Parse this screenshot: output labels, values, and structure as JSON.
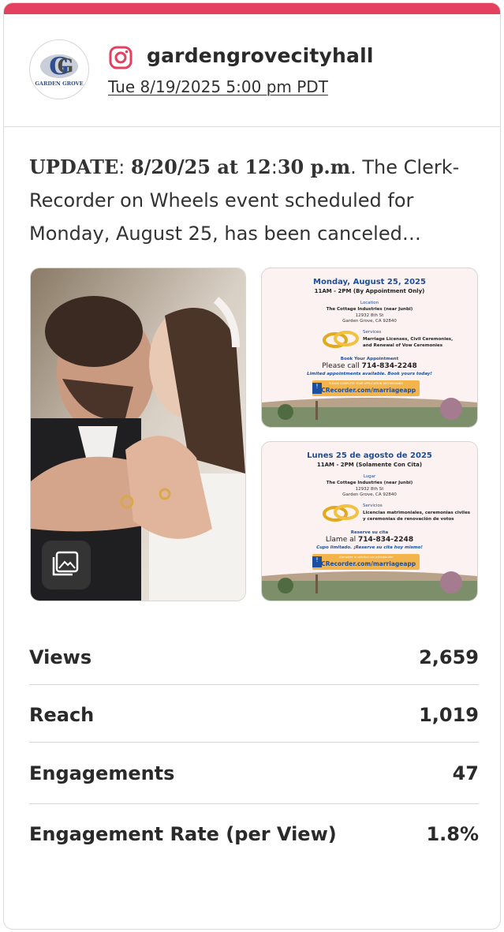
{
  "colors": {
    "accent": "#e4405f",
    "text": "#2a2a2a",
    "divider": "#d6d6d6",
    "flyer_blue": "#1b4fa0"
  },
  "account": {
    "avatar_text": "GARDEN GROVE",
    "username": "gardengrovecityhall",
    "platform_icon": "instagram-icon",
    "datetime": "Tue 8/19/2025 5:00 pm PDT"
  },
  "post": {
    "update_label": "UPDATE",
    "update_date": "8/20/25 at 12",
    "update_time_rest": "30 p.m",
    "body": ". The Clerk-Recorder on Wheels event scheduled for Monday, August 25, has been canceled…"
  },
  "media": {
    "main_icon": "gallery-icon",
    "flyer_en": {
      "date": "Monday, August 25, 2025",
      "time": "11AM - 2PM  (By Appointment Only)",
      "location_label": "Location",
      "venue": "The Cottage Industries (near Junbi)",
      "street": "12932 8th St",
      "city": "Garden Grove, CA 92840",
      "services_label": "Services",
      "services_1": "Marriage Licenses, Civil Ceremonies,",
      "services_2": "and Renewal of Vow Ceremonies",
      "book_label": "Book Your Appointment",
      "call_prefix": "Please call ",
      "phone": "714-834-2248",
      "limited": "Limited appointments available. Book yours today!",
      "app_note": "PLEASE COMPLETE YOUR APPLICATION BEFOREHAND!",
      "url": "OCRecorder.com/marriageapp"
    },
    "flyer_es": {
      "date": "Lunes 25 de agosto de 2025",
      "time": "11AM - 2PM  (Solamente Con Cita)",
      "location_label": "Lugar",
      "venue": "The Cottage Industries (near Junbi)",
      "street": "12932 8th St",
      "city": "Garden Grove, CA 92840",
      "services_label": "Servicios",
      "services_1": "Licencias matrimoniales, ceremonias civiles",
      "services_2": "y ceremonias de renovación de votos",
      "book_label": "Reserve su cita",
      "call_prefix": "Llame al ",
      "phone": "714-834-2248",
      "limited": "Cupo limitado. ¡Reserve su cita hoy mismo!",
      "app_note": "¡Complete la solicitud con anticipación!",
      "url": "OCRecorder.com/marriageapp"
    }
  },
  "stats": [
    {
      "label": "Views",
      "value": "2,659"
    },
    {
      "label": "Reach",
      "value": "1,019"
    },
    {
      "label": "Engagements",
      "value": "47"
    },
    {
      "label": "Engagement Rate (per View)",
      "value": "1.8%"
    }
  ]
}
